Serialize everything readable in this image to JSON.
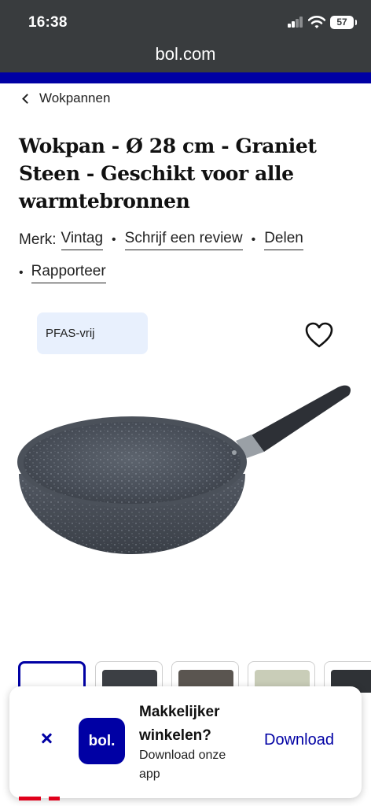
{
  "status_bar": {
    "time": "16:38",
    "battery": "57"
  },
  "browser": {
    "url": "bol.com"
  },
  "breadcrumb": {
    "label": "Wokpannen"
  },
  "product": {
    "title": "Wokpan - Ø 28 cm - Graniet Steen - Geschikt voor alle warmtebronnen",
    "brand_label": "Merk:",
    "brand": "Vintag",
    "review_link": "Schrijf een review",
    "share_link": "Delen",
    "report_link": "Rapporteer",
    "badge": "PFAS-vrij"
  },
  "app_banner": {
    "logo_text": "bol.",
    "title": "Makkelijker winkelen?",
    "subtitle": "Download onze app",
    "cta": "Download"
  },
  "colors": {
    "brand_blue": "#0000a4",
    "chrome": "#393c3e",
    "badge_bg": "#e8f0fd",
    "price_red": "#e0001b"
  },
  "icons": [
    "signal-icon",
    "wifi-icon",
    "battery-icon",
    "chevron-left-icon",
    "heart-icon",
    "close-icon"
  ]
}
